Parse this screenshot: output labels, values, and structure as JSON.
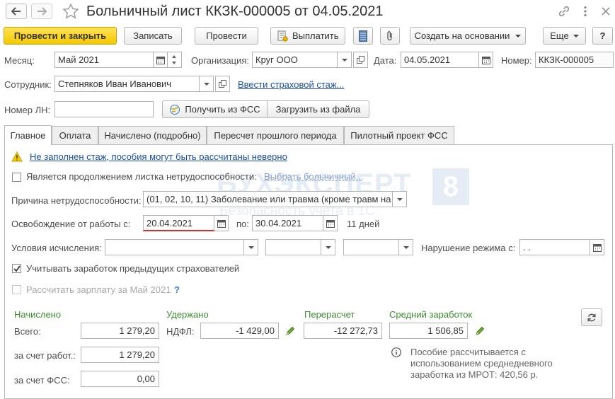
{
  "window": {
    "title": "Больничный лист ККЗК-000005 от 04.05.2021"
  },
  "toolbar": {
    "post_close": "Провести и закрыть",
    "save": "Записать",
    "post": "Провести",
    "pay": "Выплатить",
    "create_based": "Создать на основании",
    "more": "Еще",
    "help": "?"
  },
  "header": {
    "month_label": "Месяц:",
    "month_value": "Май 2021",
    "org_label": "Организация:",
    "org_value": "Круг ООО",
    "date_label": "Дата:",
    "date_value": "04.05.2021",
    "number_label": "Номер:",
    "number_value": "ККЗК-000005",
    "employee_label": "Сотрудник:",
    "employee_value": "Степняков Иван Иванович",
    "insurance_link": "Ввести страховой стаж...",
    "ln_label": "Номер ЛН:",
    "ln_value": "",
    "get_fss": "Получить из ФСС",
    "load_file": "Загрузить из файла"
  },
  "tabs": [
    "Главное",
    "Оплата",
    "Начислено (подробно)",
    "Пересчет прошлого периода",
    "Пилотный проект ФСС"
  ],
  "main": {
    "warning": "Не заполнен стаж, пособия могут быть рассчитаны неверно",
    "continuation_label": "Является продолжением листка нетрудоспособности:",
    "choose_sick_leave": "Выбрать больничный...",
    "reason_label": "Причина нетрудоспособности:",
    "reason_value": "(01, 02, 10, 11) Заболевание или травма (кроме травм на",
    "release_label": "Освобождение от работы с:",
    "release_from": "20.04.2021",
    "to_label": "по:",
    "release_to": "30.04.2021",
    "days": "11 дней",
    "conditions_label": "Условия исчисления:",
    "violation_label": "Нарушение режима с:",
    "violation_value": " .  .",
    "prev_insurers": "Учитывать заработок предыдущих страхователей",
    "calc_salary": "Рассчитать зарплату за Май 2021",
    "calc_help": "?"
  },
  "totals": {
    "accrued_title": "Начислено",
    "total_label": "Всего:",
    "total_value": "1 279,20",
    "employer_label": "за счет работ.:",
    "employer_value": "1 279,20",
    "fss_label": "за счет ФСС:",
    "fss_value": "0,00",
    "withheld_title": "Удержано",
    "ndfl_label": "НДФЛ:",
    "ndfl_value": "-1 429,00",
    "recalc_title": "Перерасчет",
    "recalc_value": "-12 272,73",
    "avg_title": "Средний заработок",
    "avg_value": "1 506,85",
    "info_text_1": "Пособие рассчитывается с",
    "info_text_2": "использованием среднедневного",
    "info_text_3": "заработка из МРОТ: 420,56 р."
  },
  "watermark": {
    "text_1": "БУХЭКСПЕРТ",
    "text_2": "Безопасность учета в 1С",
    "badge": "8"
  },
  "colors": {
    "accent_yellow": "#f5c900",
    "link": "#1a4fa0",
    "green": "#3b8e2f",
    "error_underline": "#d33030"
  }
}
